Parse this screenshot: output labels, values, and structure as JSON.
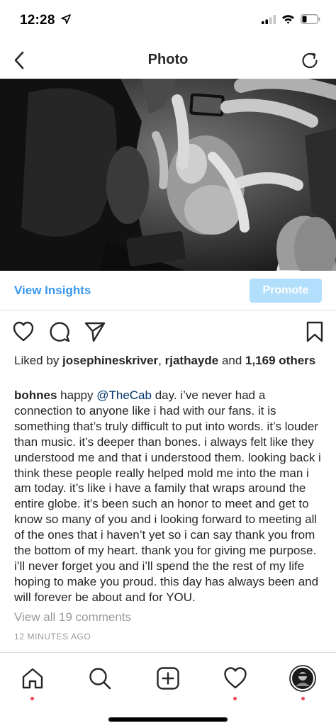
{
  "status_bar": {
    "time": "12:28"
  },
  "nav": {
    "title": "Photo"
  },
  "insights": {
    "view_label": "View Insights",
    "promote_label": "Promote"
  },
  "likes": {
    "prefix": "Liked by ",
    "user1": "josephineskriver",
    "sep": ", ",
    "user2": "rjathayde",
    "and": " and ",
    "count": "1,169 others"
  },
  "caption": {
    "username": "bohnes",
    "pre": " happy ",
    "mention": "@TheCab",
    "text": " day. i’ve never had a connection to anyone like i had with our fans. it is something that’s truly difficult to put into words. it’s louder than music. it’s deeper than bones. i always felt like they understood me and that i understood them. looking back i think these people really helped mold me into the man i am today. it’s like i have a family that wraps around the entire globe. it’s been such an honor to meet and get to know so many of you and i looking forward to meeting all of the ones that i haven’t yet so i can say thank you from the bottom of my heart. thank you for giving me purpose. i’ll never forget you and i’ll spend the the rest of my life hoping to make you proud. this day has always been and will forever be about and for YOU."
  },
  "comments": {
    "view_all": "View all 19 comments",
    "time_ago": "12 MINUTES AGO"
  },
  "colors": {
    "link": "#3897f0",
    "promote_bg": "#b2dffc",
    "notification_dot": "#ed4956",
    "muted": "#999999"
  },
  "icons": [
    "location-arrow-icon",
    "signal-icon",
    "wifi-icon",
    "battery-icon",
    "back-chevron-icon",
    "refresh-icon",
    "heart-icon",
    "comment-icon",
    "share-icon",
    "bookmark-icon",
    "home-icon",
    "search-icon",
    "add-post-icon",
    "activity-heart-icon",
    "profile-avatar"
  ]
}
